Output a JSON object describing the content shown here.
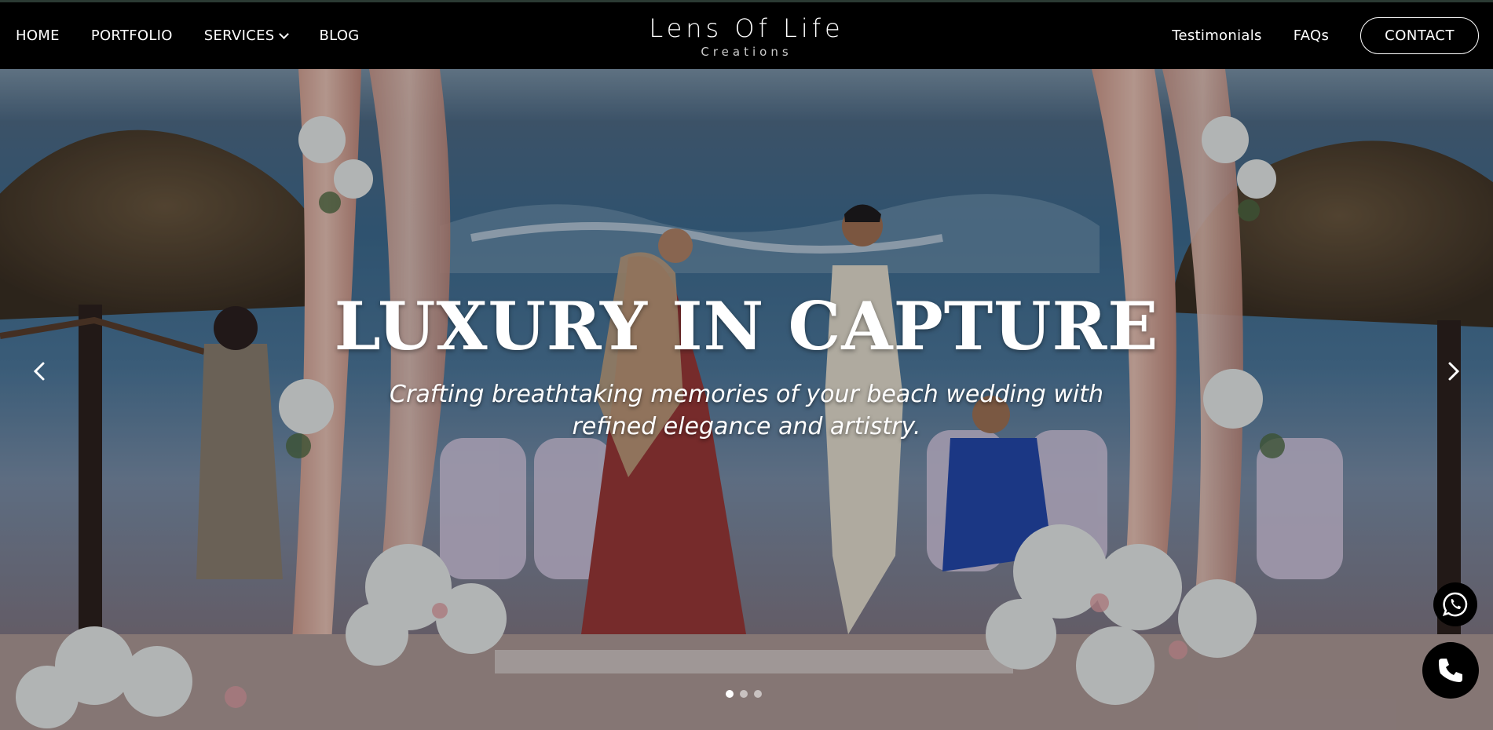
{
  "nav": {
    "left": [
      {
        "label": "HOME"
      },
      {
        "label": "PORTFOLIO"
      },
      {
        "label": "SERVICES"
      },
      {
        "label": "BLOG"
      }
    ],
    "right": [
      {
        "label": "Testimonials"
      },
      {
        "label": "FAQs"
      }
    ],
    "contact_label": "CONTACT"
  },
  "brand": {
    "name": "Lens Of Life",
    "subtitle": "Creations"
  },
  "hero": {
    "headline": "LUXURY IN CAPTURE",
    "tagline_line1": "Crafting breathtaking memories of your beach wedding with",
    "tagline_line2": "refined elegance and artistry.",
    "slides": {
      "count": 3,
      "active_index": 1
    }
  },
  "icons": {
    "services_dropdown": "chevron-down-icon",
    "prev": "chevron-left-icon",
    "next": "chevron-right-icon",
    "whatsapp": "whatsapp-icon",
    "call": "phone-icon"
  },
  "colors": {
    "header_bg": "#000000",
    "text": "#ffffff"
  }
}
